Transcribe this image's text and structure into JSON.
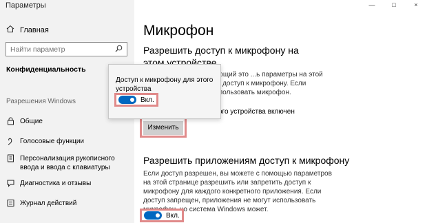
{
  "window": {
    "title": "Параметры",
    "controls": [
      "—",
      "□",
      "×"
    ]
  },
  "sidebar": {
    "home_label": "Главная",
    "search_placeholder": "Найти параметр",
    "category": "Конфиденциальность",
    "section_heading": "Разрешения Windows",
    "items": [
      {
        "label": "Общие",
        "icon": "lock-icon"
      },
      {
        "label": "Голосовые функции",
        "icon": "speech-icon"
      },
      {
        "label": "Персонализация рукописного ввода и ввода с клавиатуры",
        "icon": "pen-icon"
      },
      {
        "label": "Диагностика и отзывы",
        "icon": "feedback-icon"
      },
      {
        "label": "Журнал действий",
        "icon": "activity-icon"
      }
    ]
  },
  "main": {
    "page_title": "Микрофон",
    "device_heading": "Разрешить доступ к микрофону на этом устройстве",
    "device_desc": "...ый человек, использующий это ...ь параметры на этой странице ...риложениям доступ к микрофону. Если ...иложения не могут использовать микрофон.",
    "device_status": "ого устройства включен",
    "change_button": "Изменить",
    "apps_heading": "Разрешить приложениям доступ к микрофону",
    "apps_desc": "Если доступ разрешен, вы можете с помощью параметров на этой странице разрешить или запретить доступ к микрофону для каждого конкретного приложения. Если доступ запрещен, приложения не могут использовать микрофон, но система Windows может.",
    "apps_toggle_label": "Вкл."
  },
  "popup": {
    "title": "Доступ к микрофону для этого устройства",
    "toggle_label": "Вкл."
  },
  "colors": {
    "accent": "#0067c0",
    "highlight": "#e08a8a",
    "sidebar_bg": "#f2f2f2"
  }
}
